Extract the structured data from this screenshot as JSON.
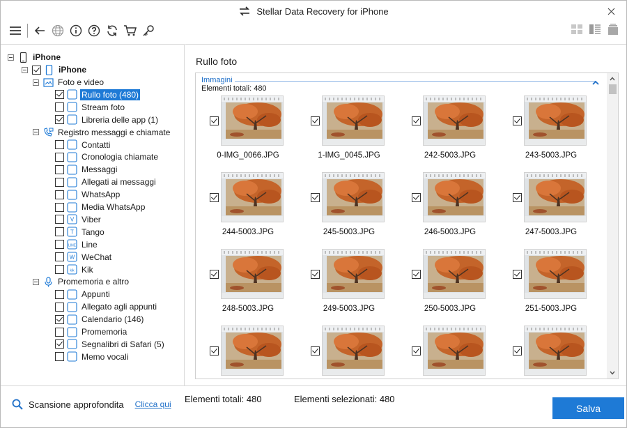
{
  "window": {
    "title": "Stellar Data Recovery for iPhone"
  },
  "toolbar": {
    "icons": [
      "menu-icon",
      "back-icon",
      "globe-icon",
      "info-icon",
      "help-icon",
      "refresh-icon",
      "cart-icon",
      "key-icon"
    ],
    "view_icons": [
      "grid-view-icon",
      "list-view-icon",
      "stack-view-icon"
    ]
  },
  "tree": {
    "root": "iPhone",
    "device": "iPhone",
    "groups": [
      {
        "label": "Foto e video",
        "items": [
          {
            "label": "Rullo foto (480)",
            "checked": true,
            "selected": true
          },
          {
            "label": "Stream foto",
            "checked": false
          },
          {
            "label": "Libreria delle app (1)",
            "checked": true
          }
        ]
      },
      {
        "label": "Registro messaggi e chiamate",
        "items": [
          {
            "label": "Contatti",
            "checked": false
          },
          {
            "label": "Cronologia chiamate",
            "checked": false
          },
          {
            "label": "Messaggi",
            "checked": false
          },
          {
            "label": "Allegati ai messaggi",
            "checked": false
          },
          {
            "label": "WhatsApp",
            "checked": false
          },
          {
            "label": "Media WhatsApp",
            "checked": false
          },
          {
            "label": "Viber",
            "checked": false
          },
          {
            "label": "Tango",
            "checked": false
          },
          {
            "label": "Line",
            "checked": false
          },
          {
            "label": "WeChat",
            "checked": false
          },
          {
            "label": "Kik",
            "checked": false
          }
        ]
      },
      {
        "label": "Promemoria e altro",
        "items": [
          {
            "label": "Appunti",
            "checked": false
          },
          {
            "label": "Allegato agli appunti",
            "checked": false
          },
          {
            "label": "Calendario (146)",
            "checked": true
          },
          {
            "label": "Promemoria",
            "checked": false
          },
          {
            "label": "Segnalibri di Safari (5)",
            "checked": true
          },
          {
            "label": "Memo vocali",
            "checked": false
          }
        ]
      }
    ]
  },
  "main": {
    "title": "Rullo foto",
    "group_name": "Immagini",
    "group_count": "Elementi totali: 480",
    "files": [
      "0-IMG_0066.JPG",
      "1-IMG_0045.JPG",
      "242-5003.JPG",
      "243-5003.JPG",
      "244-5003.JPG",
      "245-5003.JPG",
      "246-5003.JPG",
      "247-5003.JPG",
      "248-5003.JPG",
      "249-5003.JPG",
      "250-5003.JPG",
      "251-5003.JPG",
      "",
      "",
      "",
      ""
    ]
  },
  "footer": {
    "deep_scan": "Scansione approfondita",
    "click_here": "Clicca qui",
    "total": "Elementi totali: 480",
    "selected": "Elementi selezionati: 480",
    "save": "Salva"
  },
  "colors": {
    "accent": "#1e7ad6",
    "link": "#1e6fc8"
  }
}
